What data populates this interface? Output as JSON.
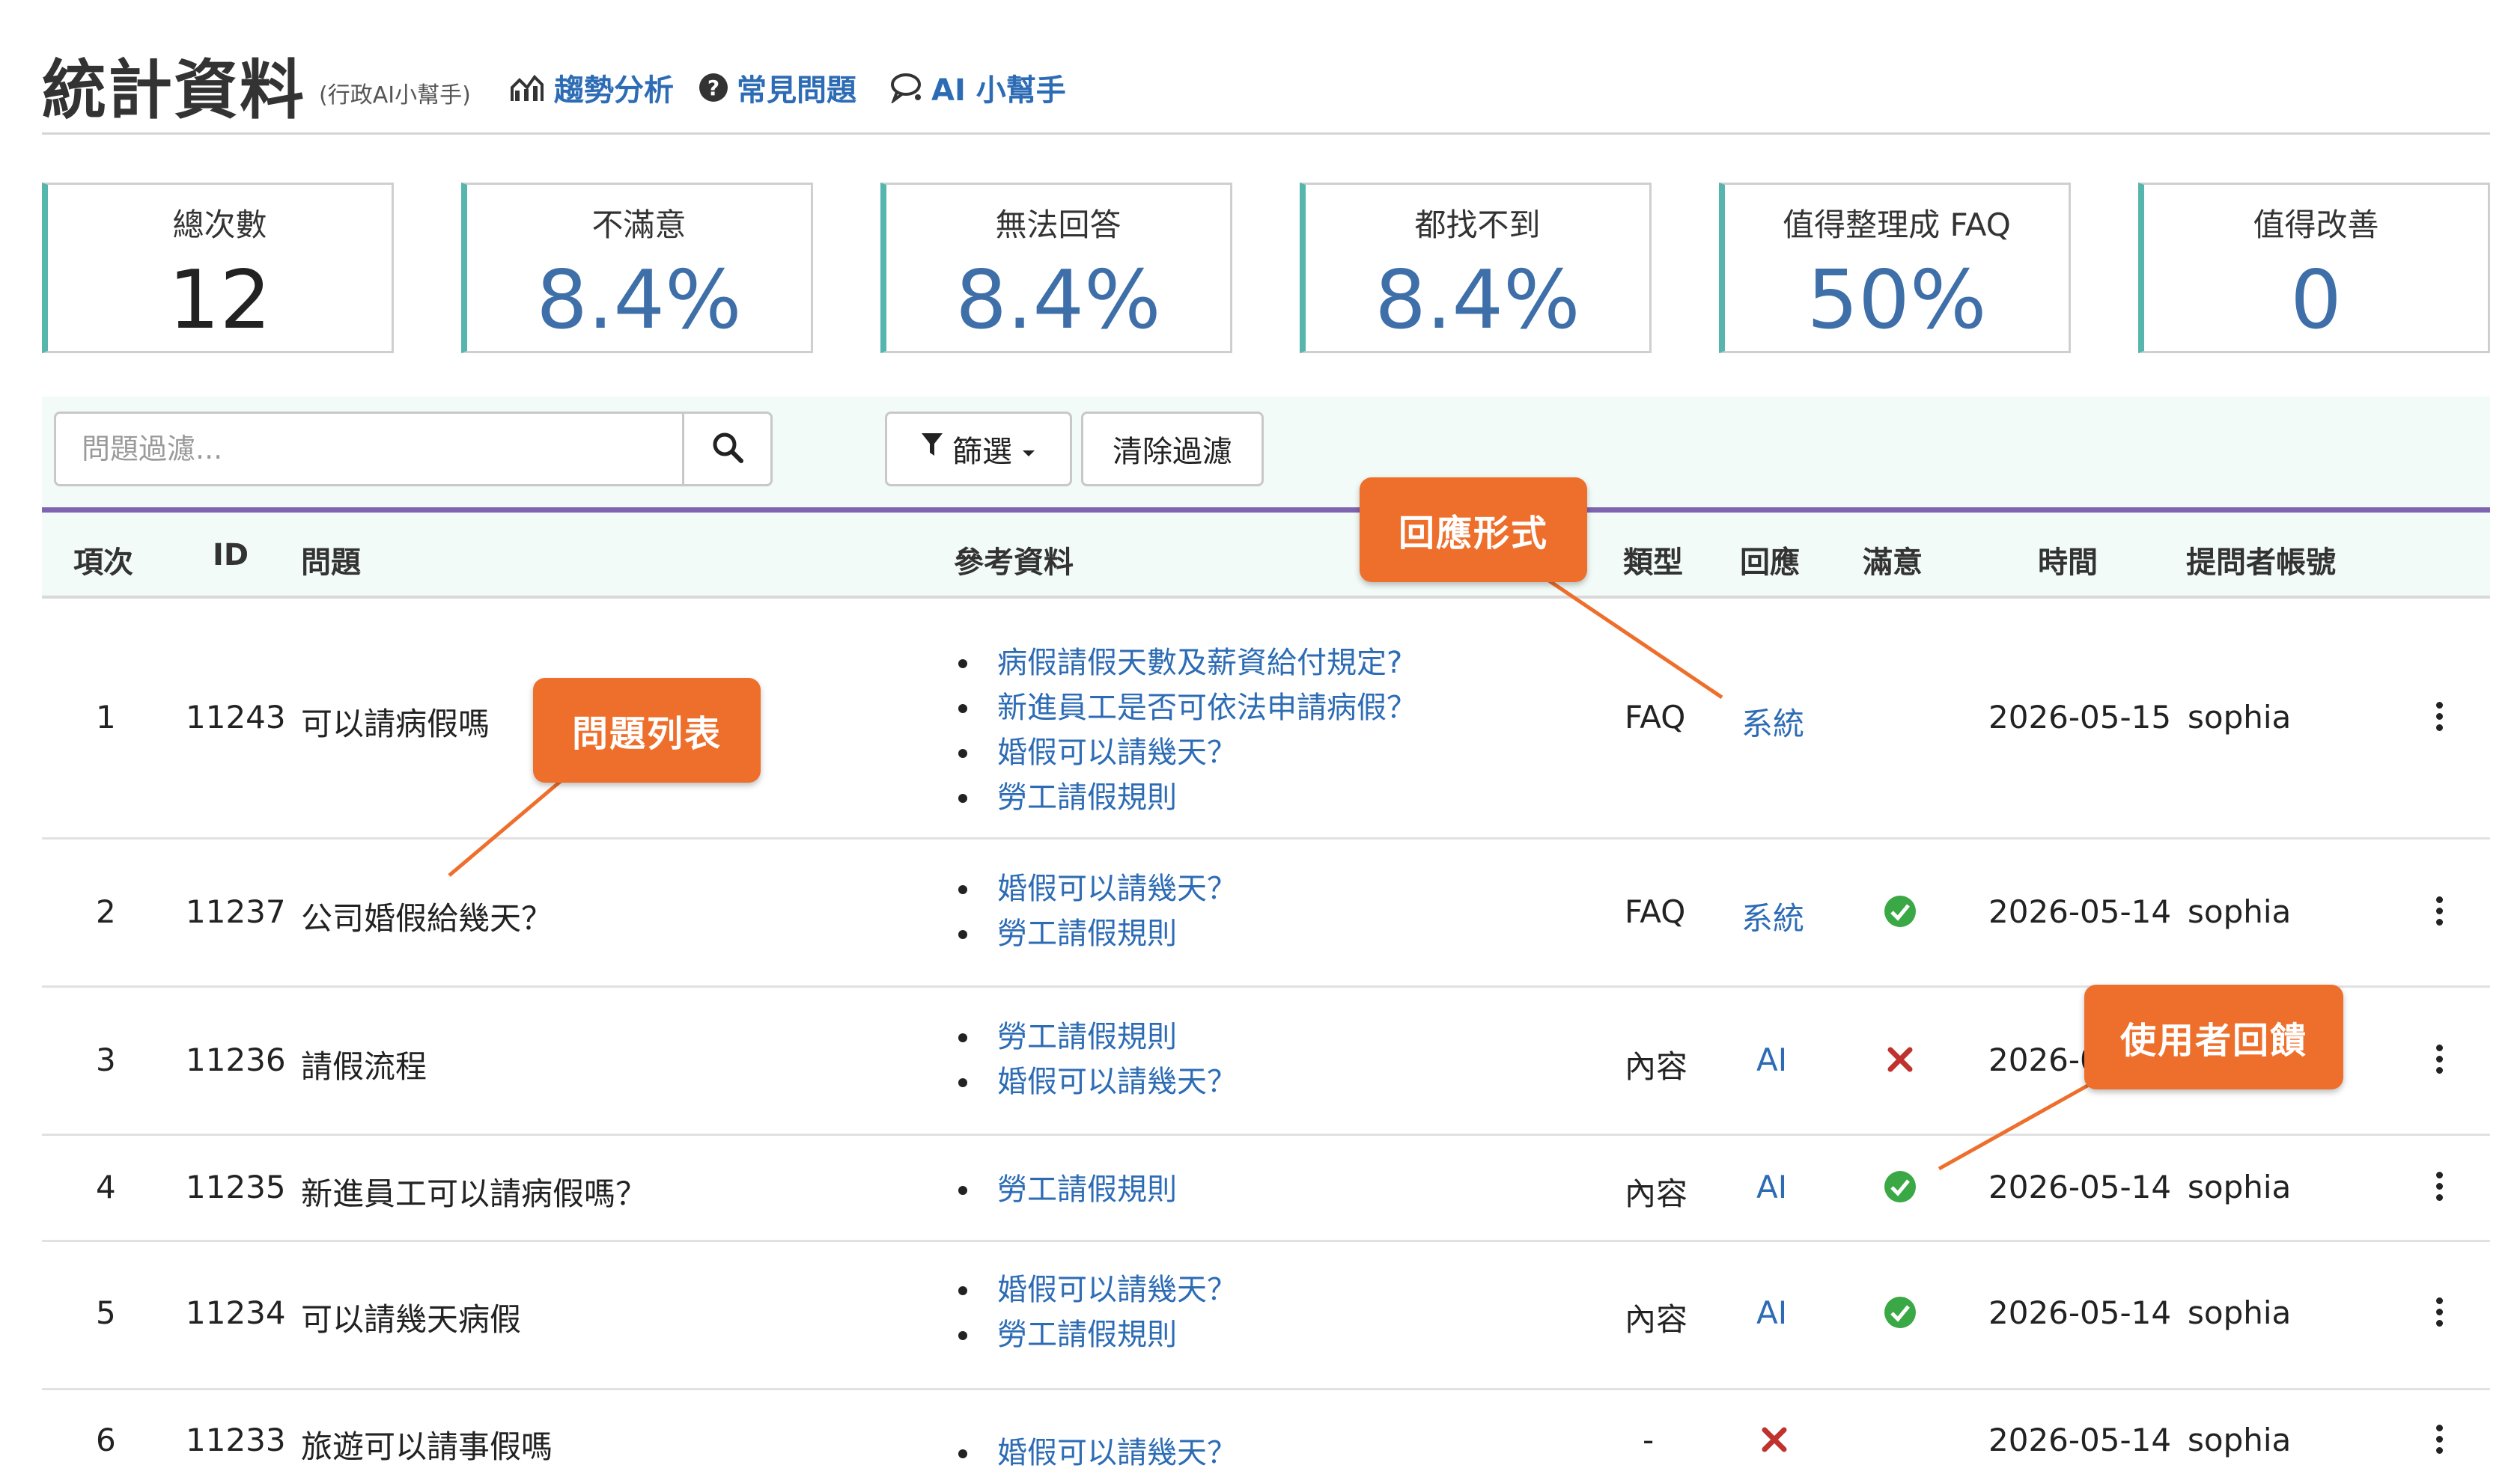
{
  "header": {
    "title": "統計資料",
    "subtitle": "(行政AI小幫手)",
    "links": [
      {
        "label": "趨勢分析",
        "icon": "chart-icon"
      },
      {
        "label": "常見問題",
        "icon": "question-circle-icon"
      },
      {
        "label": "AI 小幫手",
        "icon": "chat-bubble-icon"
      }
    ]
  },
  "stats": [
    {
      "label": "總次數",
      "value": "12"
    },
    {
      "label": "不滿意",
      "value": "8.4%"
    },
    {
      "label": "無法回答",
      "value": "8.4%"
    },
    {
      "label": "都找不到",
      "value": "8.4%"
    },
    {
      "label": "值得整理成 FAQ",
      "value": "50%"
    },
    {
      "label": "值得改善",
      "value": "0"
    }
  ],
  "filter": {
    "search_placeholder": "問題過濾...",
    "filter_label": "篩選",
    "clear_label": "清除過濾"
  },
  "table": {
    "headers": {
      "index": "項次",
      "id": "ID",
      "question": "問題",
      "refs": "參考資料",
      "type": "類型",
      "response": "回應",
      "satisfied": "滿意",
      "time": "時間",
      "user": "提問者帳號"
    },
    "rows": [
      {
        "index": "1",
        "id": "11243",
        "question": "可以請病假嗎",
        "refs": [
          "病假請假天數及薪資給付規定?",
          "新進員工是否可依法申請病假？",
          "婚假可以請幾天？",
          "勞工請假規則"
        ],
        "type": "FAQ",
        "response": "系統",
        "satisfied": "",
        "time": "2026-05-15",
        "user": "sophia"
      },
      {
        "index": "2",
        "id": "11237",
        "question": "公司婚假給幾天？",
        "refs": [
          "婚假可以請幾天？",
          "勞工請假規則"
        ],
        "type": "FAQ",
        "response": "系統",
        "satisfied": "yes",
        "time": "2026-05-14",
        "user": "sophia"
      },
      {
        "index": "3",
        "id": "11236",
        "question": "請假流程",
        "refs": [
          "勞工請假規則",
          "婚假可以請幾天？"
        ],
        "type": "內容",
        "response": "AI",
        "satisfied": "no",
        "time": "2026-05-14",
        "user": "sophia"
      },
      {
        "index": "4",
        "id": "11235",
        "question": "新進員工可以請病假嗎？",
        "refs": [
          "勞工請假規則"
        ],
        "type": "內容",
        "response": "AI",
        "satisfied": "yes",
        "time": "2026-05-14",
        "user": "sophia"
      },
      {
        "index": "5",
        "id": "11234",
        "question": "可以請幾天病假",
        "refs": [
          "婚假可以請幾天？",
          "勞工請假規則"
        ],
        "type": "內容",
        "response": "AI",
        "satisfied": "yes",
        "time": "2026-05-14",
        "user": "sophia"
      },
      {
        "index": "6",
        "id": "11233",
        "question": "旅遊可以請事假嗎",
        "refs": [
          "婚假可以請幾天？"
        ],
        "type": "-",
        "response": "",
        "response_icon": "x",
        "satisfied": "",
        "time": "2026-05-14",
        "user": "sophia"
      }
    ]
  },
  "annotations": [
    {
      "label": "回應形式"
    },
    {
      "label": "問題列表"
    },
    {
      "label": "使用者回饋"
    }
  ],
  "colors": {
    "accent_link": "#2d6cb5",
    "card_border_left": "#56b6ae",
    "stat_value": "#3e6fa8",
    "table_top_border": "#7f64b0",
    "callout": "#ee6f2b",
    "check_green": "#3aa845",
    "cross_red": "#c0322d"
  }
}
